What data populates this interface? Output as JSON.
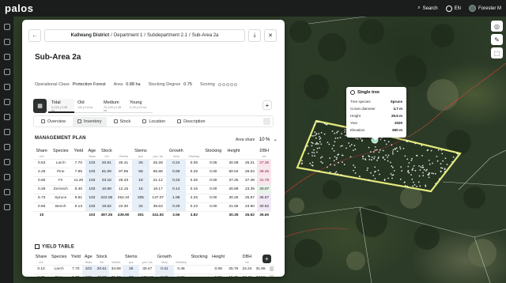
{
  "app": {
    "logo": "palos"
  },
  "topbar": {
    "search": "Search",
    "language": "EN",
    "user": "Forester M"
  },
  "panel": {
    "breadcrumb": {
      "district": "Kallwang District",
      "department": "Department 1",
      "subdepartment": "Subdepartment 2.1",
      "subarea": "Sub-Area 2a",
      "sep": "/"
    },
    "title": "Sub-Area 2a",
    "meta": {
      "class_label": "Operational Class",
      "class_value": "Protection Forest",
      "area_label": "Area",
      "area_value": "0.88 ha",
      "stocking_label": "Stocking Degree",
      "stocking_value": "0.75",
      "scoring_label": "Scoring"
    },
    "age_tabs": [
      {
        "label": "Total",
        "sub": "0–100 y   0.88 ha"
      },
      {
        "label": "Old",
        "sub": "100 y   0.6 ha"
      },
      {
        "label": "Medium",
        "sub": "20–100 y   0.38 ha"
      },
      {
        "label": "Young",
        "sub": "0–20 y   0.0 ha"
      }
    ],
    "tabs": [
      "Overview",
      "Inventory",
      "Stock",
      "Location",
      "Description"
    ],
    "management": {
      "title": "MANAGEMENT PLAN",
      "area_share_label": "Area share",
      "area_share_value": "10",
      "area_share_unit": "%",
      "headers": [
        "Share",
        "Species",
        "Yield",
        "Age",
        "Stock",
        "",
        "Stems",
        "",
        "Growth",
        "",
        "Stocking",
        "Height",
        "",
        "DBH",
        ""
      ],
      "units": [
        "x10",
        "",
        "",
        "Years",
        "Vm",
        "Vfm/ha",
        "pcs",
        "pcs / ha",
        "Vm/y",
        "Vfm/ha/y",
        "",
        "",
        "",
        "cm",
        ""
      ],
      "rows": [
        [
          "0.53",
          "Larch",
          "7.70",
          "103",
          "20.61",
          "25.41",
          "26",
          "25.28",
          "0.24",
          "0.05",
          "0.05",
          "30.09",
          "26.21",
          "27.36"
        ],
        [
          "2.25",
          "Pine",
          "7.95",
          "103",
          "81.09",
          "97.95",
          "58",
          "65.88",
          "0.69",
          "0.26",
          "0.00",
          "50.04",
          "26.04",
          "38.45"
        ],
        [
          "0.60",
          "Fir",
          "11.20",
          "103",
          "23.18",
          "26.33",
          "18",
          "21.12",
          "0.23",
          "0.26",
          "0.00",
          "37.25",
          "27.48",
          "41.78"
        ],
        [
          "0.29",
          "Zernisch",
          "6.40",
          "103",
          "10.68",
          "12.15",
          "16",
          "18.17",
          "0.14",
          "0.15",
          "0.00",
          "26.89",
          "23.39",
          "30.07"
        ],
        [
          "5.73",
          "Spruce",
          "9.81",
          "103",
          "222.06",
          "252.34",
          "205",
          "137.07",
          "1.98",
          "2.25",
          "0.00",
          "30.25",
          "25.87",
          "36.67"
        ],
        [
          "0.50",
          "Beech",
          "6.13",
          "103",
          "19.62",
          "22.30",
          "34",
          "38.63",
          "0.29",
          "0.23",
          "0.00",
          "21.55",
          "23.60",
          "30.62"
        ]
      ],
      "total_row": [
        "10",
        "",
        "",
        "103",
        "387.26",
        "439.90",
        "301",
        "341.92",
        "3.56",
        "3.82",
        "",
        "30.35",
        "26.62",
        "36.60"
      ]
    },
    "yield_table": {
      "title": "YIELD TABLE",
      "headers": [
        "Share",
        "Species",
        "Yield",
        "Age",
        "Stock",
        "",
        "Stems",
        "",
        "Growth",
        "",
        "Stocking",
        "Height",
        "",
        "DBH",
        ""
      ],
      "units": [
        "x10",
        "",
        "",
        "Years",
        "Vm",
        "Vfm/ha",
        "pcs",
        "pcs / ha",
        "Vm/y",
        "Vfm/ha/y",
        "",
        "",
        "",
        "cm",
        ""
      ],
      "rows": [
        [
          "0.10",
          "Larch",
          "7.70",
          "103",
          "20.61",
          "34.68",
          "26",
          "30.47",
          "0.41",
          "0.46",
          "",
          "0.08",
          "25.76",
          "24.24",
          "31.95"
        ],
        [
          "2.25",
          "Pine",
          "5.77",
          "103",
          "43.23",
          "71.83",
          "97",
          "109.67",
          "0.69",
          "0.96",
          "",
          "0.08",
          "15.35",
          "23.48",
          "27.55"
        ],
        [
          "",
          "",
          "",
          "103",
          "",
          "",
          "",
          "",
          "",
          "",
          "",
          "",
          "",
          "",
          ""
        ]
      ]
    }
  },
  "popup": {
    "title": "Single tree",
    "rows": [
      {
        "label": "Tree species",
        "value": "Spruce"
      },
      {
        "label": "Crown diameter",
        "value": "4.7 m"
      },
      {
        "label": "Height",
        "value": "25.5 m"
      },
      {
        "label": "Year",
        "value": "2020"
      },
      {
        "label": "Elevation",
        "value": "600 m"
      }
    ]
  },
  "colors": {
    "accent": "#e3ea7c",
    "highlight_blue": "#e6eef8",
    "highlight_green": "#e7f4ea",
    "highlight_red": "#f9e6ec"
  }
}
